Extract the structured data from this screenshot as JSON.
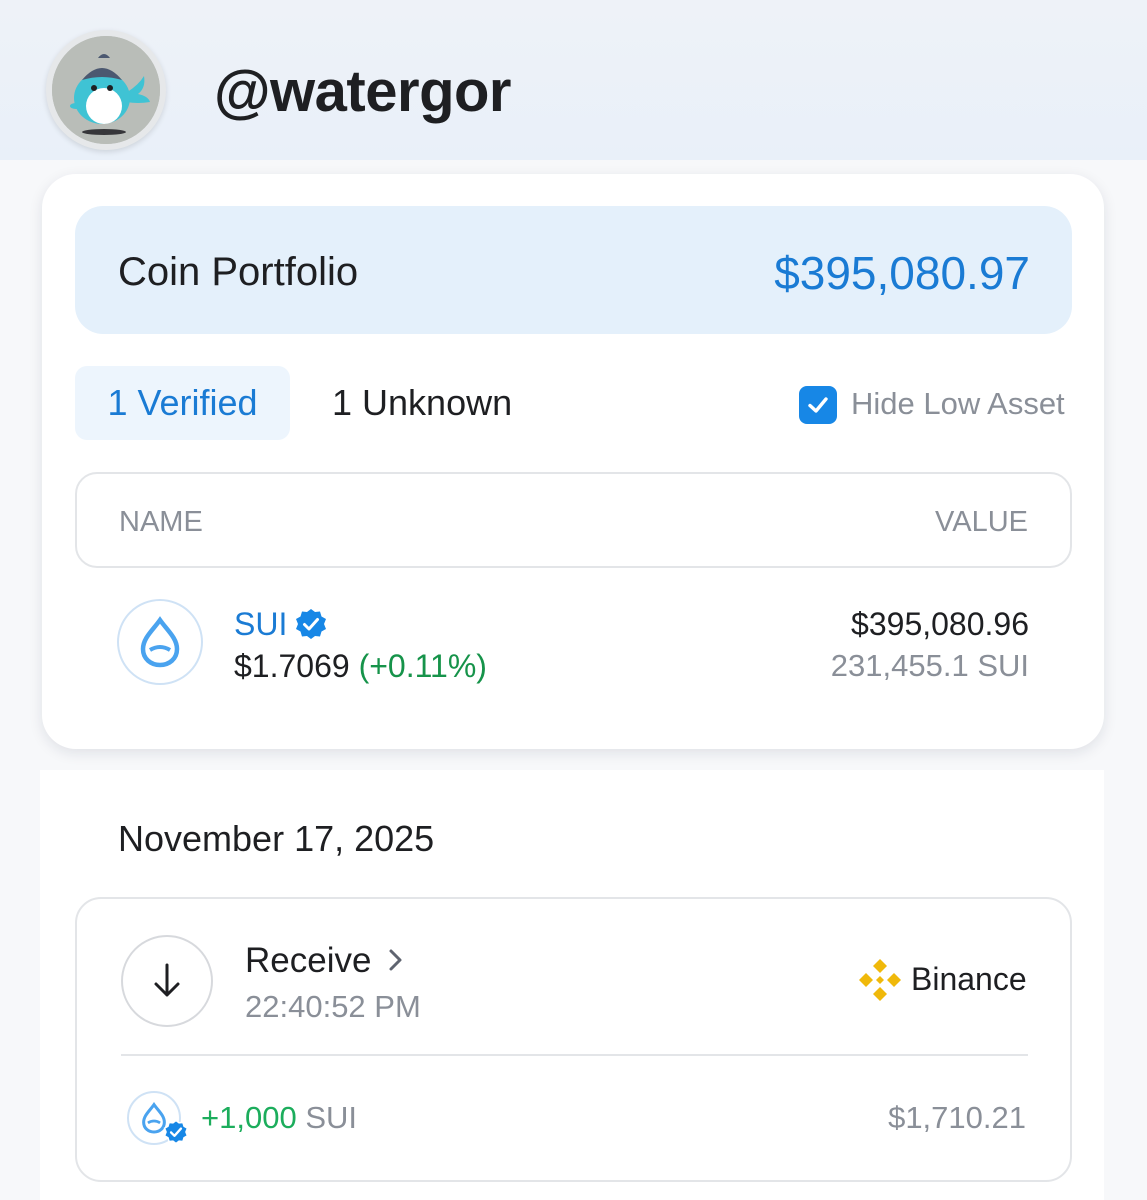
{
  "profile": {
    "username": "@watergor",
    "avatar_icon": "whale-avatar-icon"
  },
  "portfolio": {
    "title": "Coin Portfolio",
    "total_value": "$395,080.97",
    "tabs": [
      {
        "label": "1 Verified",
        "active": true
      },
      {
        "label": "1 Unknown",
        "active": false
      }
    ],
    "hide_low_asset": {
      "label": "Hide Low Asset",
      "checked": true
    },
    "table": {
      "headers": {
        "name": "NAME",
        "value": "VALUE"
      },
      "rows": [
        {
          "symbol": "SUI",
          "verified": true,
          "price": "$1.7069",
          "change": "(+0.11%)",
          "usd_value": "$395,080.96",
          "amount": "231,455.1 SUI",
          "icon": "sui-drop-icon"
        }
      ]
    }
  },
  "activity": {
    "date": "November 17, 2025",
    "transactions": [
      {
        "type": "Receive",
        "time": "22:40:52 PM",
        "counterparty": "Binance",
        "amount": "+1,000",
        "unit": "SUI",
        "usd_value": "$1,710.21"
      }
    ]
  },
  "colors": {
    "accent": "#1a7bd4",
    "positive": "#16934a",
    "binance": "#f0b90b"
  }
}
